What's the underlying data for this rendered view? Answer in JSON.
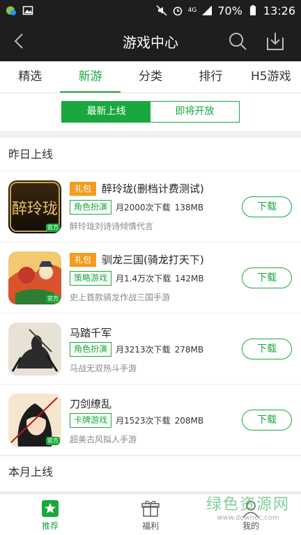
{
  "status_bar": {
    "battery": "70%",
    "time": "13:26",
    "network": "4G"
  },
  "header": {
    "title": "游戏中心"
  },
  "tabs": [
    "精选",
    "新游",
    "分类",
    "排行",
    "H5游戏"
  ],
  "segment": {
    "latest": "最新上线",
    "upcoming": "即将开放"
  },
  "sections": {
    "yesterday": "昨日上线",
    "month": "本月上线"
  },
  "apps": [
    {
      "gift": "礼包",
      "name": "醉玲珑(删档计费测试)",
      "category": "角色扮演",
      "downloads": "月2000次下载",
      "size": "138MB",
      "desc": "醉玲珑刘诗诗倾情代言",
      "button": "下载",
      "badge": "官方"
    },
    {
      "gift": "礼包",
      "name": "驯龙三国(骑龙打天下)",
      "category": "策略游戏",
      "downloads": "月1.4万次下载",
      "size": "142MB",
      "desc": "史上首款骑龙作战三国手游",
      "button": "下载",
      "badge": "官方"
    },
    {
      "gift": "",
      "name": "马踏千军",
      "category": "角色扮演",
      "downloads": "月3213次下载",
      "size": "278MB",
      "desc": "马战无双热斗手游",
      "button": "下载",
      "badge": ""
    },
    {
      "gift": "",
      "name": "刀剑缭乱",
      "category": "卡牌游戏",
      "downloads": "月1523次下载",
      "size": "208MB",
      "desc": "超美古风拟人手游",
      "button": "下载",
      "badge": "官方"
    }
  ],
  "icon_text": {
    "app1": "醉玲珑"
  },
  "bottom_nav": {
    "recommend": "推荐",
    "welfare": "福利",
    "mine": "我的"
  },
  "watermark": {
    "cn": "绿色资源网",
    "url": "www.downcc.com"
  },
  "colors": {
    "accent": "#19a83d",
    "gift": "#f39c1e",
    "header": "#1e1e1e"
  }
}
